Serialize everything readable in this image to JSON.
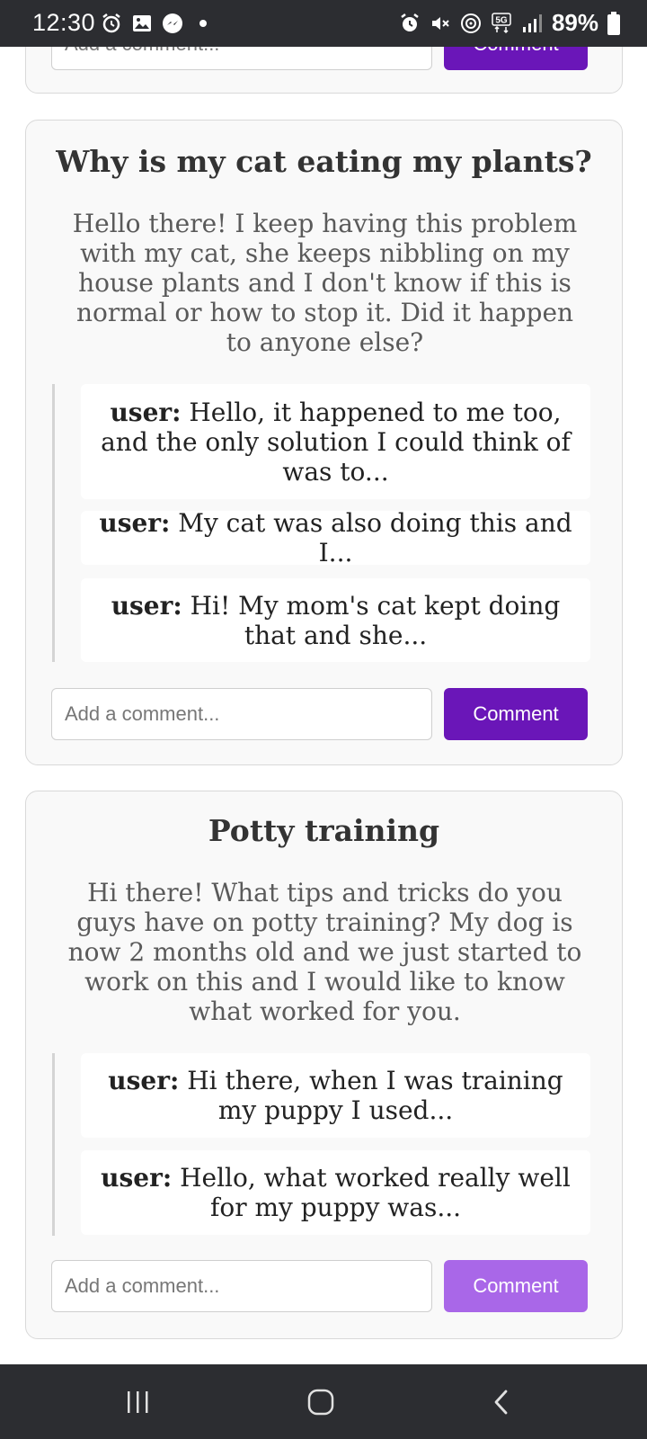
{
  "status_bar": {
    "time": "12:30",
    "battery": "89%",
    "network": "5G"
  },
  "posts": [
    {
      "title": "",
      "body": "",
      "replies": [],
      "comment_placeholder": "Add a comment...",
      "comment_button": "Comment"
    },
    {
      "title": "Why is my cat eating my plants?",
      "body": "Hello there! I keep having this problem with my cat, she keeps nibbling on my house plants and I don't know if this is normal or how to stop it. Did it happen to anyone else?",
      "replies": [
        {
          "user": "user:",
          "text": "Hello, it happened to me too, and the only solution I could think of was to..."
        },
        {
          "user": "user:",
          "text": "My cat was also doing this and I..."
        },
        {
          "user": "user:",
          "text": "Hi! My mom's cat kept doing that and she..."
        }
      ],
      "comment_placeholder": "Add a comment...",
      "comment_button": "Comment"
    },
    {
      "title": "Potty training",
      "body": "Hi there! What tips and tricks do you guys have on potty training? My dog is now 2 months old and we just started to work on this and I would like to know what worked for you.",
      "replies": [
        {
          "user": "user:",
          "text": "Hi there, when I was training my puppy I used..."
        },
        {
          "user": "user:",
          "text": "Hello, what worked really well for my puppy was..."
        }
      ],
      "comment_placeholder": "Add a comment...",
      "comment_button": "Comment"
    }
  ],
  "colors": {
    "button_active": "#6a16b8",
    "button_inactive": "#a967e8",
    "bar": "#2c2d31"
  }
}
